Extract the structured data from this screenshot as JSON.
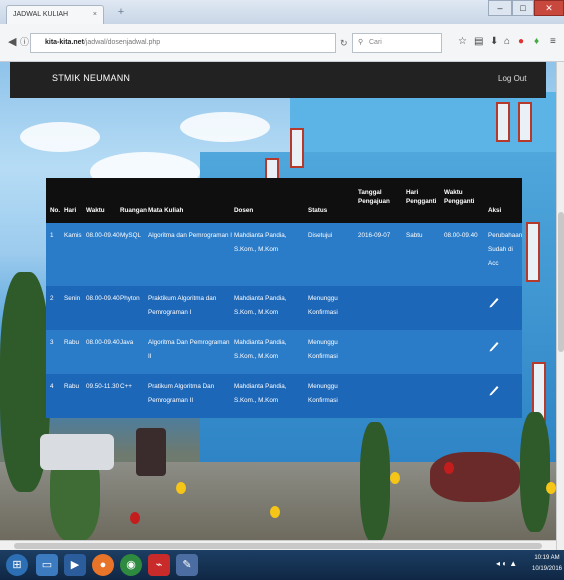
{
  "browser": {
    "tab_title": "JADWAL KULIAH NEUMANN",
    "tab_close": "×",
    "new_tab": "+",
    "url_host": "kita-kita.net",
    "url_path": "/jadwal/dosenjadwal.php",
    "search_placeholder": "Cari"
  },
  "site": {
    "brand": "STMIK NEUMANN",
    "logout": "Log Out"
  },
  "table": {
    "headers": [
      "No.",
      "Hari",
      "Waktu",
      "Ruangan",
      "Mata Kuliah",
      "Dosen",
      "Status",
      "Tanggal Pengajuan",
      "Hari Pengganti",
      "Waktu Pengganti",
      "Aksi"
    ],
    "rows": [
      {
        "no": "1",
        "hari": "Kamis",
        "waktu": "08.00-09.40",
        "ruangan": "MySQL",
        "mata_kuliah": "Algoritma dan Pemrograman I",
        "dosen": "Mahdianta Pandia, S.Kom., M.Kom",
        "status": "Disetujui",
        "tanggal": "2016-09-07",
        "hari_pengganti": "Sabtu",
        "waktu_pengganti": "08.00-09.40",
        "aksi": "Perubahaan Sudah di Acc"
      },
      {
        "no": "2",
        "hari": "Senin",
        "waktu": "08.00-09.40",
        "ruangan": "Phyton",
        "mata_kuliah": "Praktikum Algoritma dan Pemrograman I",
        "dosen": "Mahdianta Pandia, S.Kom., M.Kom",
        "status": "Menunggu Konfirmasi",
        "tanggal": "",
        "hari_pengganti": "",
        "waktu_pengganti": "",
        "aksi": "edit-icon"
      },
      {
        "no": "3",
        "hari": "Rabu",
        "waktu": "08.00-09.40",
        "ruangan": "Java",
        "mata_kuliah": "Algoritma Dan Pemrograman II",
        "dosen": "Mahdianta Pandia, S.Kom., M.Kom",
        "status": "Menunggu Konfirmasi",
        "tanggal": "",
        "hari_pengganti": "",
        "waktu_pengganti": "",
        "aksi": "edit-icon"
      },
      {
        "no": "4",
        "hari": "Rabu",
        "waktu": "09.50-11.30",
        "ruangan": "C++",
        "mata_kuliah": "Pratikum Algoritma Dan Pemrograman II",
        "dosen": "Mahdianta Pandia, S.Kom., M.Kom",
        "status": "Menunggu Konfirmasi",
        "tanggal": "",
        "hari_pengganti": "",
        "waktu_pengganti": "",
        "aksi": "edit-icon"
      }
    ]
  },
  "taskbar": {
    "time": "10:19 AM",
    "date": "10/19/2016"
  },
  "colors": {
    "header_bar": "#222222",
    "table_head": "#0f0f0f",
    "table_row": "#1d67b9",
    "accent_close": "#c9483e"
  }
}
